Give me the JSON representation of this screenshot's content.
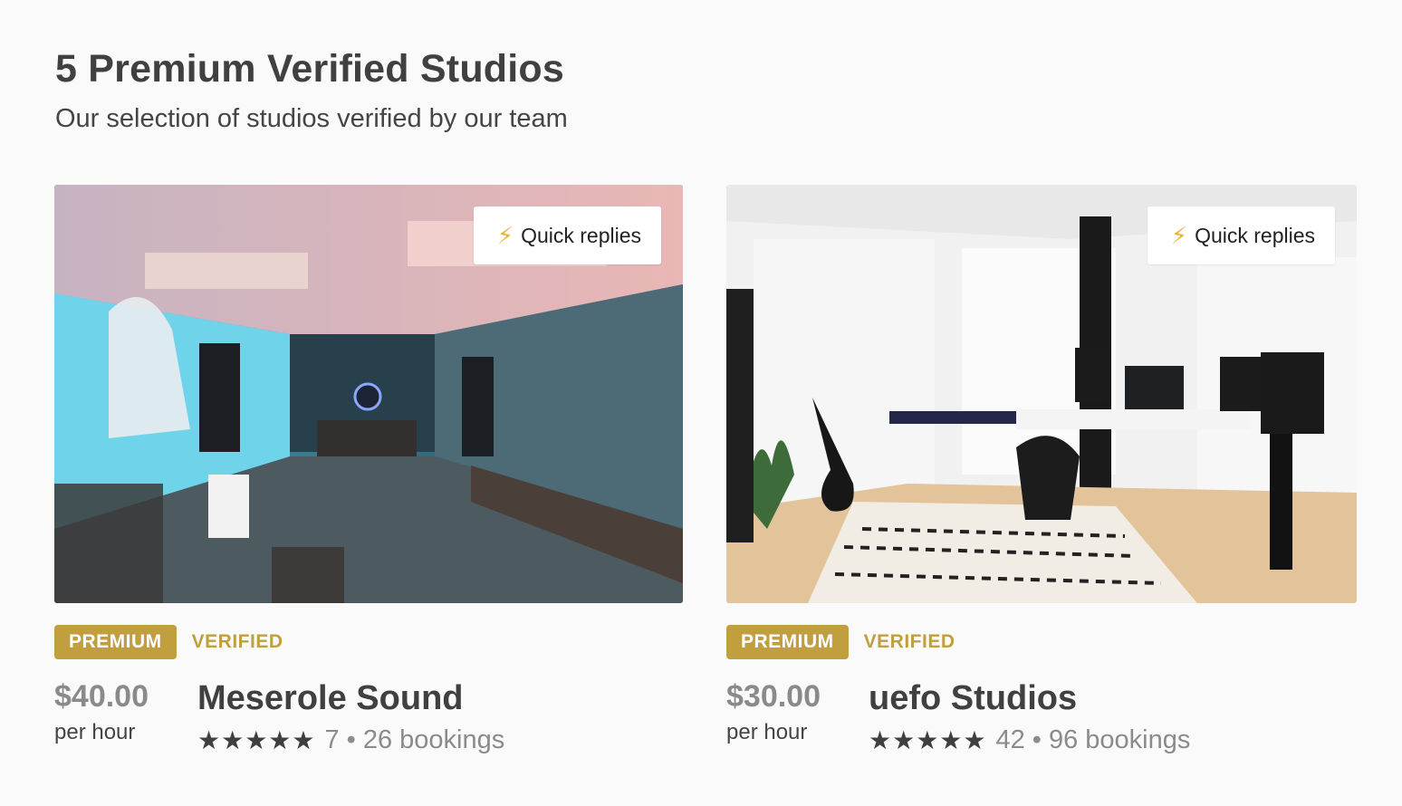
{
  "section": {
    "title": "5 Premium Verified Studios",
    "subtitle": "Our selection of studios verified by our team"
  },
  "icons": {
    "quick": "lightning-bolt-icon",
    "star": "star-icon"
  },
  "colors": {
    "gold": "#c29f3e",
    "bolt": "#f0b232"
  },
  "studios": [
    {
      "quick_label": "Quick replies",
      "premium_label": "PREMIUM",
      "verified_label": "VERIFIED",
      "price": "$40.00",
      "per": "per hour",
      "name": "Meserole Sound",
      "stars": "★★★★★",
      "reviews": "7",
      "separator": "•",
      "bookings": "26 bookings"
    },
    {
      "quick_label": "Quick replies",
      "premium_label": "PREMIUM",
      "verified_label": "VERIFIED",
      "price": "$30.00",
      "per": "per hour",
      "name": "uefo Studios",
      "stars": "★★★★★",
      "reviews": "42",
      "separator": "•",
      "bookings": "96 bookings"
    }
  ]
}
